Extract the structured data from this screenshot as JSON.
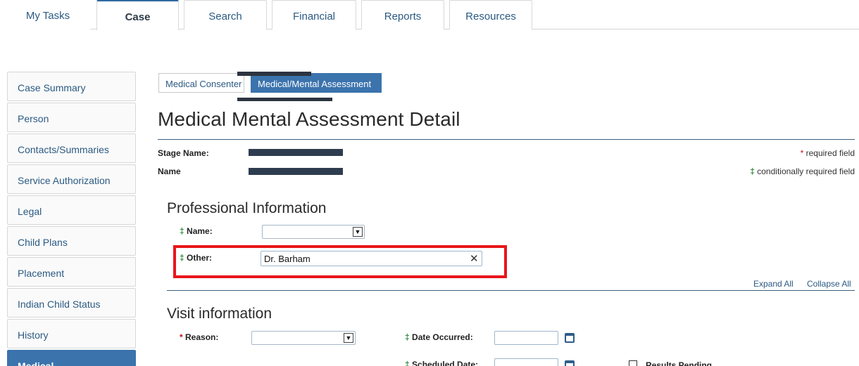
{
  "topnav": {
    "tabs": [
      {
        "label": "My Tasks"
      },
      {
        "label": "Case"
      },
      {
        "label": "Search"
      },
      {
        "label": "Financial"
      },
      {
        "label": "Reports"
      },
      {
        "label": "Resources"
      }
    ]
  },
  "sidebar": {
    "items": [
      {
        "label": "Case Summary"
      },
      {
        "label": "Person"
      },
      {
        "label": "Contacts/Summaries"
      },
      {
        "label": "Service Authorization"
      },
      {
        "label": "Legal"
      },
      {
        "label": "Child Plans"
      },
      {
        "label": "Placement"
      },
      {
        "label": "Indian Child Status"
      },
      {
        "label": "History"
      },
      {
        "label": "Medical"
      }
    ]
  },
  "subtabs": {
    "consenter": "Medical Consenter",
    "assessment": "Medical/Mental Assessment"
  },
  "page_title": "Medical Mental Assessment Detail",
  "meta": {
    "stage_name_label": "Stage Name:",
    "name_label": "Name",
    "required_text": "required field",
    "conditional_text": "conditionally required field",
    "star": "*",
    "dagger": "‡"
  },
  "professional": {
    "heading": "Professional Information",
    "name_label": "Name:",
    "other_label": "Other:",
    "other_value": "Dr. Barham",
    "clear": "✕"
  },
  "links": {
    "expand_all": "Expand All",
    "collapse_all": "Collapse All"
  },
  "visit": {
    "heading": "Visit information",
    "reason_label": "Reason:",
    "date_occurred_label": "Date Occurred:",
    "scheduled_date_label": "Scheduled Date:",
    "results_pending_label": "Results Pending"
  },
  "colors": {
    "accent": "#3b73ad",
    "highlight": "#e8161b",
    "required": "#c0111b",
    "conditional": "#2e8b3a"
  },
  "icons": [
    "caret-down-icon",
    "clear-icon",
    "calendar-icon"
  ]
}
